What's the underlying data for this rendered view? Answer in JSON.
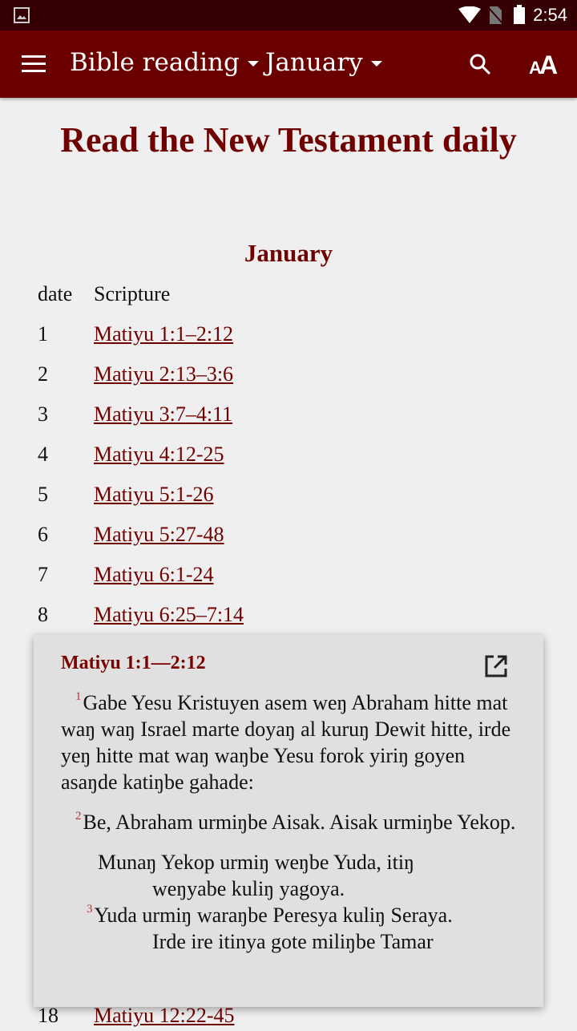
{
  "status_bar": {
    "time": "2:54"
  },
  "app_bar": {
    "reading_plan": "Bible reading",
    "month": "January"
  },
  "page": {
    "title": "Read the New Testament daily",
    "month_heading": "January",
    "columns": {
      "date": "date",
      "scripture": "Scripture"
    },
    "rows": [
      {
        "date": "1",
        "ref": "Matiyu 1:1–2:12"
      },
      {
        "date": "2",
        "ref": "Matiyu 2:13–3:6"
      },
      {
        "date": "3",
        "ref": "Matiyu 3:7–4:11"
      },
      {
        "date": "4",
        "ref": "Matiyu 4:12-25"
      },
      {
        "date": "5",
        "ref": "Matiyu 5:1-26"
      },
      {
        "date": "6",
        "ref": "Matiyu 5:27-48"
      },
      {
        "date": "7",
        "ref": "Matiyu 6:1-24"
      },
      {
        "date": "8",
        "ref": "Matiyu 6:25–7:14"
      },
      {
        "date": "18",
        "ref": "Matiyu 12:22-45"
      }
    ]
  },
  "popup": {
    "reference": "Matiyu 1:1—2:12",
    "v1_num": "1",
    "v1": "Gabe Yesu Kristuyen asem weŋ Abraham hitte mat waŋ waŋ Israel marte doyaŋ al kuruŋ Dewit hitte, irde yeŋ hitte mat waŋ waŋbe Yesu forok yiriŋ goyen asaŋde katiŋbe gahade:",
    "v2_num": "2",
    "v2": "Be, Abraham urmiŋbe Aisak. Aisak urmiŋbe Yekop.",
    "poem1": "Munaŋ Yekop urmiŋ weŋbe Yuda, itiŋ",
    "poem1b": "weŋyabe kuliŋ yagoya.",
    "v3_num": "3",
    "v3": "Yuda urmiŋ waraŋbe Peresya kuliŋ Seraya.",
    "v3b": "Irde ire itinya gote miliŋbe Tamar"
  },
  "colors": {
    "app_bar": "#6b0000",
    "status_bar": "#350004",
    "accent": "#700000"
  }
}
